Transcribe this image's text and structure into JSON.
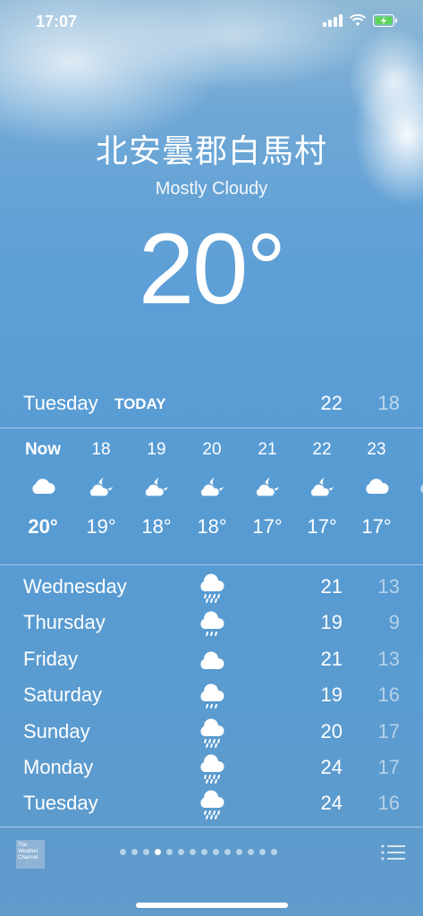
{
  "status": {
    "time": "17:07"
  },
  "location": {
    "city": "北安曇郡白馬村",
    "condition": "Mostly Cloudy",
    "temperature": "20°"
  },
  "today": {
    "day": "Tuesday",
    "tag": "TODAY",
    "high": "22",
    "low": "18"
  },
  "hourly": [
    {
      "time": "Now",
      "icon": "cloud-icon",
      "temp": "20°"
    },
    {
      "time": "18",
      "icon": "partly-cloudy-night-icon",
      "temp": "19°"
    },
    {
      "time": "19",
      "icon": "partly-cloudy-night-icon",
      "temp": "18°"
    },
    {
      "time": "20",
      "icon": "partly-cloudy-night-icon",
      "temp": "18°"
    },
    {
      "time": "21",
      "icon": "partly-cloudy-night-icon",
      "temp": "17°"
    },
    {
      "time": "22",
      "icon": "partly-cloudy-night-icon",
      "temp": "17°"
    },
    {
      "time": "23",
      "icon": "cloud-icon",
      "temp": "17°"
    }
  ],
  "daily": [
    {
      "day": "Wednesday",
      "icon": "rain-icon",
      "high": "21",
      "low": "13"
    },
    {
      "day": "Thursday",
      "icon": "drizzle-icon",
      "high": "19",
      "low": "9"
    },
    {
      "day": "Friday",
      "icon": "cloud-icon",
      "high": "21",
      "low": "13"
    },
    {
      "day": "Saturday",
      "icon": "drizzle-icon",
      "high": "19",
      "low": "16"
    },
    {
      "day": "Sunday",
      "icon": "rain-icon",
      "high": "20",
      "low": "17"
    },
    {
      "day": "Monday",
      "icon": "rain-icon",
      "high": "24",
      "low": "17"
    },
    {
      "day": "Tuesday",
      "icon": "rain-icon",
      "high": "24",
      "low": "16"
    }
  ],
  "footer": {
    "logo_text": "The Weather Channel",
    "pages": 14,
    "active_page": 4
  }
}
